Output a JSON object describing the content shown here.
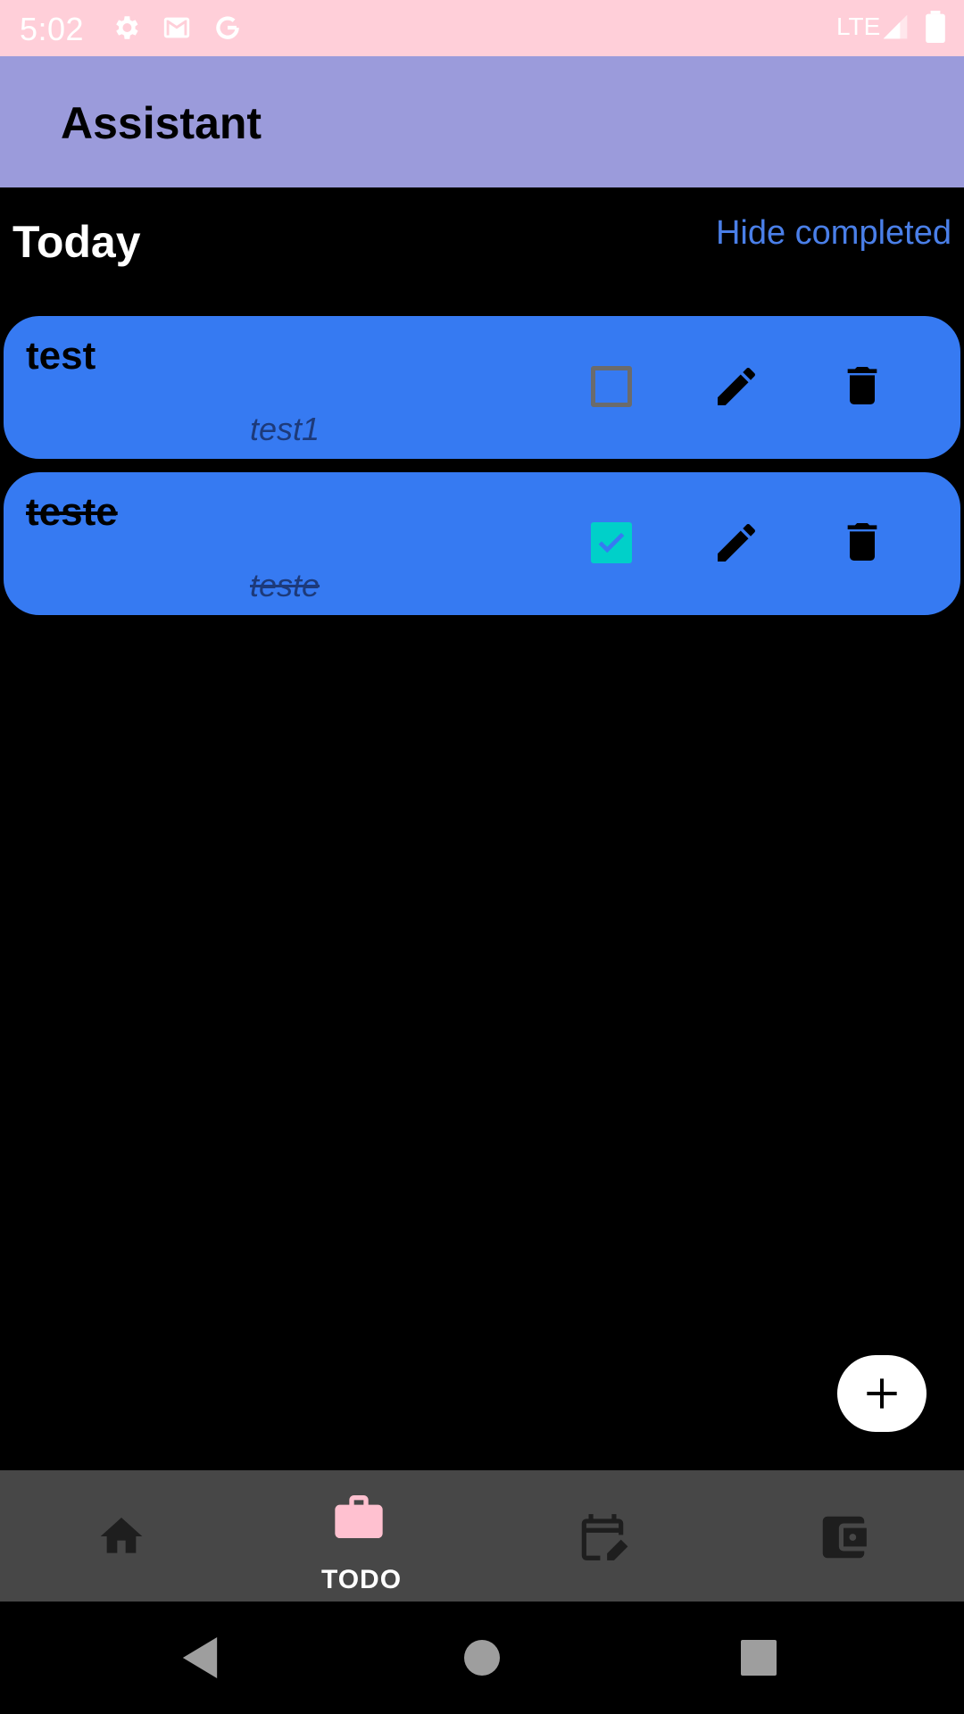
{
  "status_bar": {
    "time": "5:02",
    "network": "LTE",
    "icons": [
      "settings-icon",
      "gmail-icon",
      "google-icon",
      "signal-icon",
      "battery-icon"
    ]
  },
  "app_bar": {
    "title": "Assistant"
  },
  "section": {
    "title": "Today",
    "hide_completed_label": "Hide completed"
  },
  "tasks": [
    {
      "title": "test",
      "description": "test1",
      "completed": false
    },
    {
      "title": "teste",
      "description": "teste",
      "completed": true
    }
  ],
  "bottom_nav": {
    "items": [
      {
        "icon": "home-icon",
        "label": ""
      },
      {
        "icon": "briefcase-icon",
        "label": "TODO",
        "active": true
      },
      {
        "icon": "calendar-edit-icon",
        "label": ""
      },
      {
        "icon": "wallet-icon",
        "label": ""
      }
    ]
  },
  "colors": {
    "status_bar": "#ffcfd9",
    "app_bar": "#9b9bdb",
    "card": "#367af2",
    "link": "#4a7fe8",
    "checkbox_checked": "#00d0c9",
    "nav_active": "#ffc1d0",
    "bottom_nav": "#474747"
  },
  "system_nav": {
    "icons": [
      "back-icon",
      "home-circle-icon",
      "recents-icon"
    ]
  }
}
